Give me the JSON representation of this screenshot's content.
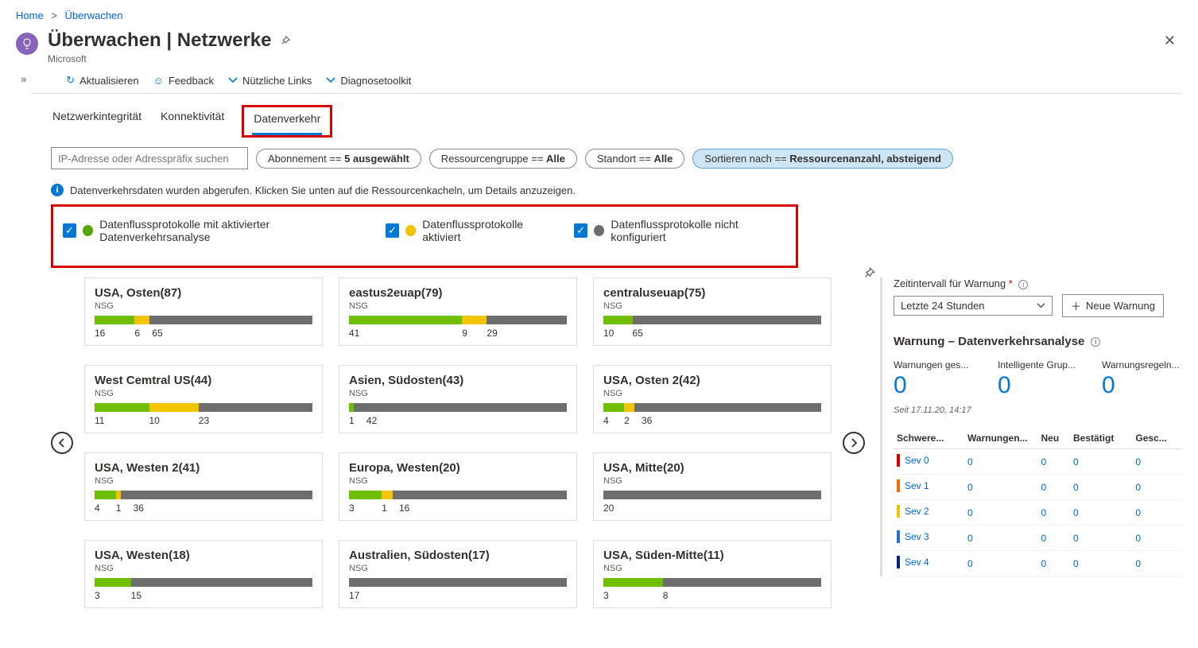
{
  "breadcrumb": {
    "home": "Home",
    "current": "Überwachen"
  },
  "header": {
    "title": "Überwachen | Netzwerke",
    "subtitle": "Microsoft"
  },
  "toolbar": {
    "refresh": "Aktualisieren",
    "feedback": "Feedback",
    "links": "Nützliche Links",
    "diag": "Diagnosetoolkit"
  },
  "tabs": {
    "integrity": "Netzwerkintegrität",
    "connectivity": "Konnektivität",
    "traffic": "Datenverkehr"
  },
  "search": {
    "placeholder": "IP-Adresse oder Adresspräfix suchen"
  },
  "filters": {
    "sub_prefix": "Abonnement == ",
    "sub_value": "5 ausgewählt",
    "rg_prefix": "Ressourcengruppe == ",
    "rg_value": "Alle",
    "loc_prefix": "Standort == ",
    "loc_value": "Alle",
    "sort_prefix": "Sortieren nach == ",
    "sort_value": "Ressourcenanzahl, absteigend"
  },
  "info": "Datenverkehrsdaten wurden abgerufen. Klicken Sie unten auf die Ressourcenkacheln, um Details anzuzeigen.",
  "legend": {
    "a": "Datenflussprotokolle mit aktivierter Datenverkehrsanalyse",
    "b": "Datenflussprotokolle aktiviert",
    "c": "Datenflussprotokolle nicht konfiguriert"
  },
  "cards": [
    {
      "title": "USA, Osten(87)",
      "sub": "NSG",
      "g": 16,
      "y": 6,
      "gr": 65
    },
    {
      "title": "eastus2euap(79)",
      "sub": "NSG",
      "g": 41,
      "y": 9,
      "gr": 29
    },
    {
      "title": "centraluseuap(75)",
      "sub": "NSG",
      "g": 10,
      "y": 0,
      "gr": 65
    },
    {
      "title": "West Cemtral US(44)",
      "sub": "NSG",
      "g": 11,
      "y": 10,
      "gr": 23
    },
    {
      "title": "Asien, Südosten(43)",
      "sub": "NSG",
      "g": 1,
      "y": 0,
      "gr": 42
    },
    {
      "title": "USA, Osten 2(42)",
      "sub": "NSG",
      "g": 4,
      "y": 2,
      "gr": 36
    },
    {
      "title": "USA, Westen 2(41)",
      "sub": "NSG",
      "g": 4,
      "y": 1,
      "gr": 36
    },
    {
      "title": "Europa, Westen(20)",
      "sub": "NSG",
      "g": 3,
      "y": 1,
      "gr": 16
    },
    {
      "title": "USA, Mitte(20)",
      "sub": "NSG",
      "g": 0,
      "y": 0,
      "gr": 20
    },
    {
      "title": "USA, Westen(18)",
      "sub": "NSG",
      "g": 3,
      "y": 0,
      "gr": 15
    },
    {
      "title": "Australien, Südosten(17)",
      "sub": "NSG",
      "g": 0,
      "y": 0,
      "gr": 17
    },
    {
      "title": "USA, Süden-Mitte(11)",
      "sub": "NSG",
      "g": 3,
      "y": 0,
      "gr": 8
    }
  ],
  "side": {
    "interval_label": "Zeitintervall für Warnung",
    "interval_value": "Letzte 24 Stunden",
    "new_alert": "Neue Warnung",
    "heading": "Warnung – Datenverkehrsanalyse",
    "m1_label": "Warnungen ges...",
    "m2_label": "Intelligente Grup...",
    "m3_label": "Warnungsregeln...",
    "m1_value": "0",
    "m2_value": "0",
    "m3_value": "0",
    "timestamp": "Seit 17.11.20, 14:17",
    "cols": {
      "c1": "Schwere...",
      "c2": "Warnungen...",
      "c3": "Neu",
      "c4": "Bestätigt",
      "c5": "Gesc..."
    },
    "rows": [
      {
        "sev": "Sev 0",
        "color": "#d40000",
        "a": "0",
        "b": "0",
        "c": "0",
        "d": "0"
      },
      {
        "sev": "Sev 1",
        "color": "#e87000",
        "a": "0",
        "b": "0",
        "c": "0",
        "d": "0"
      },
      {
        "sev": "Sev 2",
        "color": "#f0c400",
        "a": "0",
        "b": "0",
        "c": "0",
        "d": "0"
      },
      {
        "sev": "Sev 3",
        "color": "#2a6fd4",
        "a": "0",
        "b": "0",
        "c": "0",
        "d": "0"
      },
      {
        "sev": "Sev 4",
        "color": "#102080",
        "a": "0",
        "b": "0",
        "c": "0",
        "d": "0"
      }
    ]
  }
}
